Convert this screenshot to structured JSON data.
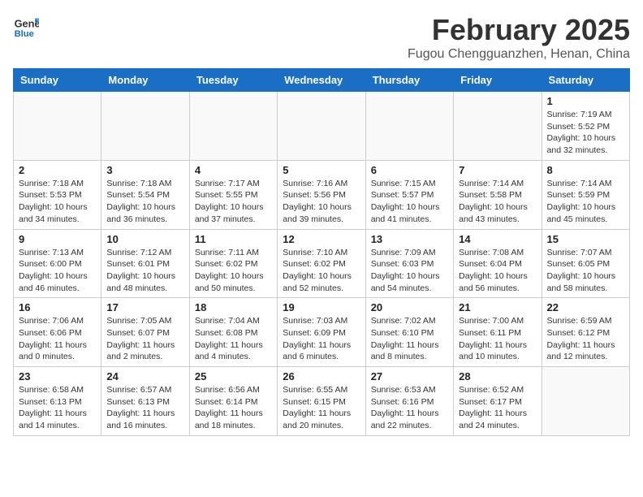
{
  "header": {
    "logo_line1": "General",
    "logo_line2": "Blue",
    "month": "February 2025",
    "location": "Fugou Chengguanzhen, Henan, China"
  },
  "weekdays": [
    "Sunday",
    "Monday",
    "Tuesday",
    "Wednesday",
    "Thursday",
    "Friday",
    "Saturday"
  ],
  "weeks": [
    [
      {
        "day": "",
        "info": ""
      },
      {
        "day": "",
        "info": ""
      },
      {
        "day": "",
        "info": ""
      },
      {
        "day": "",
        "info": ""
      },
      {
        "day": "",
        "info": ""
      },
      {
        "day": "",
        "info": ""
      },
      {
        "day": "1",
        "info": "Sunrise: 7:19 AM\nSunset: 5:52 PM\nDaylight: 10 hours and 32 minutes."
      }
    ],
    [
      {
        "day": "2",
        "info": "Sunrise: 7:18 AM\nSunset: 5:53 PM\nDaylight: 10 hours and 34 minutes."
      },
      {
        "day": "3",
        "info": "Sunrise: 7:18 AM\nSunset: 5:54 PM\nDaylight: 10 hours and 36 minutes."
      },
      {
        "day": "4",
        "info": "Sunrise: 7:17 AM\nSunset: 5:55 PM\nDaylight: 10 hours and 37 minutes."
      },
      {
        "day": "5",
        "info": "Sunrise: 7:16 AM\nSunset: 5:56 PM\nDaylight: 10 hours and 39 minutes."
      },
      {
        "day": "6",
        "info": "Sunrise: 7:15 AM\nSunset: 5:57 PM\nDaylight: 10 hours and 41 minutes."
      },
      {
        "day": "7",
        "info": "Sunrise: 7:14 AM\nSunset: 5:58 PM\nDaylight: 10 hours and 43 minutes."
      },
      {
        "day": "8",
        "info": "Sunrise: 7:14 AM\nSunset: 5:59 PM\nDaylight: 10 hours and 45 minutes."
      }
    ],
    [
      {
        "day": "9",
        "info": "Sunrise: 7:13 AM\nSunset: 6:00 PM\nDaylight: 10 hours and 46 minutes."
      },
      {
        "day": "10",
        "info": "Sunrise: 7:12 AM\nSunset: 6:01 PM\nDaylight: 10 hours and 48 minutes."
      },
      {
        "day": "11",
        "info": "Sunrise: 7:11 AM\nSunset: 6:02 PM\nDaylight: 10 hours and 50 minutes."
      },
      {
        "day": "12",
        "info": "Sunrise: 7:10 AM\nSunset: 6:02 PM\nDaylight: 10 hours and 52 minutes."
      },
      {
        "day": "13",
        "info": "Sunrise: 7:09 AM\nSunset: 6:03 PM\nDaylight: 10 hours and 54 minutes."
      },
      {
        "day": "14",
        "info": "Sunrise: 7:08 AM\nSunset: 6:04 PM\nDaylight: 10 hours and 56 minutes."
      },
      {
        "day": "15",
        "info": "Sunrise: 7:07 AM\nSunset: 6:05 PM\nDaylight: 10 hours and 58 minutes."
      }
    ],
    [
      {
        "day": "16",
        "info": "Sunrise: 7:06 AM\nSunset: 6:06 PM\nDaylight: 11 hours and 0 minutes."
      },
      {
        "day": "17",
        "info": "Sunrise: 7:05 AM\nSunset: 6:07 PM\nDaylight: 11 hours and 2 minutes."
      },
      {
        "day": "18",
        "info": "Sunrise: 7:04 AM\nSunset: 6:08 PM\nDaylight: 11 hours and 4 minutes."
      },
      {
        "day": "19",
        "info": "Sunrise: 7:03 AM\nSunset: 6:09 PM\nDaylight: 11 hours and 6 minutes."
      },
      {
        "day": "20",
        "info": "Sunrise: 7:02 AM\nSunset: 6:10 PM\nDaylight: 11 hours and 8 minutes."
      },
      {
        "day": "21",
        "info": "Sunrise: 7:00 AM\nSunset: 6:11 PM\nDaylight: 11 hours and 10 minutes."
      },
      {
        "day": "22",
        "info": "Sunrise: 6:59 AM\nSunset: 6:12 PM\nDaylight: 11 hours and 12 minutes."
      }
    ],
    [
      {
        "day": "23",
        "info": "Sunrise: 6:58 AM\nSunset: 6:13 PM\nDaylight: 11 hours and 14 minutes."
      },
      {
        "day": "24",
        "info": "Sunrise: 6:57 AM\nSunset: 6:13 PM\nDaylight: 11 hours and 16 minutes."
      },
      {
        "day": "25",
        "info": "Sunrise: 6:56 AM\nSunset: 6:14 PM\nDaylight: 11 hours and 18 minutes."
      },
      {
        "day": "26",
        "info": "Sunrise: 6:55 AM\nSunset: 6:15 PM\nDaylight: 11 hours and 20 minutes."
      },
      {
        "day": "27",
        "info": "Sunrise: 6:53 AM\nSunset: 6:16 PM\nDaylight: 11 hours and 22 minutes."
      },
      {
        "day": "28",
        "info": "Sunrise: 6:52 AM\nSunset: 6:17 PM\nDaylight: 11 hours and 24 minutes."
      },
      {
        "day": "",
        "info": ""
      }
    ]
  ]
}
